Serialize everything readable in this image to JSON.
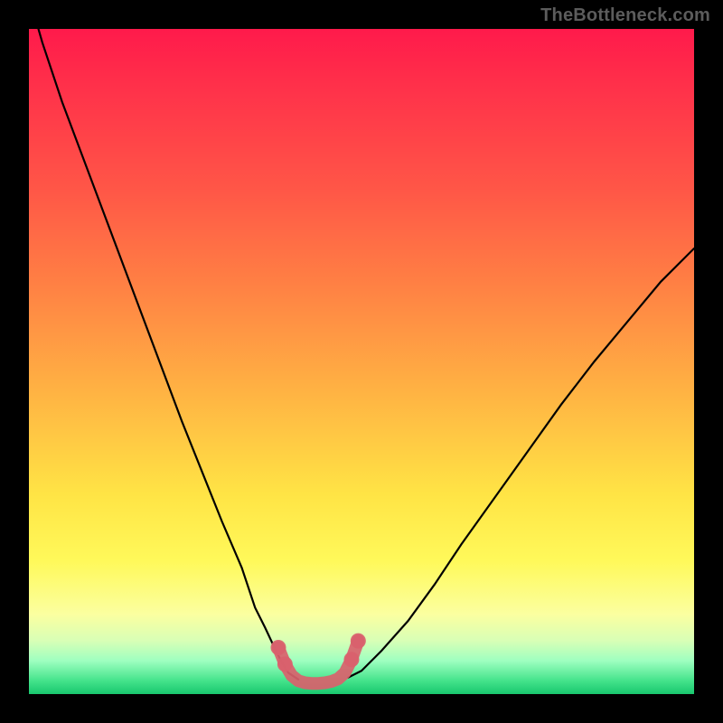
{
  "watermark": "TheBottleneck.com",
  "chart_data": {
    "type": "line",
    "title": "",
    "xlabel": "",
    "ylabel": "",
    "xlim": [
      0,
      100
    ],
    "ylim": [
      0,
      100
    ],
    "grid": false,
    "legend": false,
    "series": [
      {
        "name": "curve-left",
        "x": [
          0,
          2,
          5,
          8,
          11,
          14,
          17,
          20,
          23,
          26,
          29,
          32,
          34,
          35.5,
          37,
          38,
          39,
          40.5
        ],
        "values": [
          105,
          98,
          89,
          81,
          73,
          65,
          57,
          49,
          41,
          33.5,
          26,
          19,
          13,
          10,
          6.8,
          4.8,
          3.2,
          2.2
        ]
      },
      {
        "name": "curve-right",
        "x": [
          48,
          50,
          53,
          57,
          61,
          65,
          70,
          75,
          80,
          85,
          90,
          95,
          100
        ],
        "values": [
          2.5,
          3.5,
          6.5,
          11,
          16.5,
          22.5,
          29.5,
          36.5,
          43.5,
          50,
          56,
          62,
          67
        ]
      },
      {
        "name": "highlight-region",
        "x": [
          37.5,
          38.5,
          39.5,
          40.5,
          41.5,
          42.5,
          43.5,
          44.5,
          45.5,
          46.5,
          47.5,
          48.5,
          49.5
        ],
        "values": [
          7.0,
          4.5,
          2.8,
          2.0,
          1.7,
          1.6,
          1.6,
          1.7,
          1.9,
          2.3,
          3.2,
          5.2,
          8.0
        ]
      }
    ],
    "colors": {
      "curve": "#000000",
      "highlight": "#d9616d"
    }
  }
}
